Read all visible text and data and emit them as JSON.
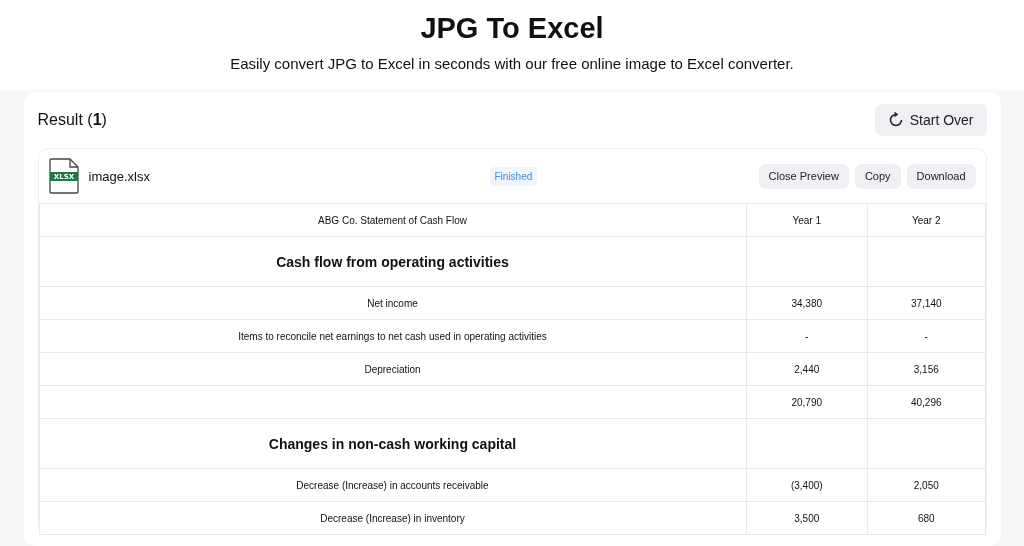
{
  "header": {
    "title": "JPG To Excel",
    "subtitle": "Easily convert JPG to Excel in seconds with our free online image to Excel converter."
  },
  "result": {
    "label": "Result (",
    "count": "1",
    "close": ")",
    "start_over": "Start Over"
  },
  "file": {
    "badge": "XLSX",
    "name": "image.xlsx",
    "status": "Finished",
    "actions": [
      "Close Preview",
      "Copy",
      "Download"
    ]
  },
  "table": {
    "rows": [
      {
        "kind": "text",
        "cells": [
          "ABG Co. Statement of Cash Flow",
          "Year 1",
          "Year 2"
        ]
      },
      {
        "kind": "heading",
        "cells": [
          "Cash flow from operating activities",
          "",
          ""
        ]
      },
      {
        "kind": "text",
        "cells": [
          "Net income",
          "34,380",
          "37,140"
        ]
      },
      {
        "kind": "text",
        "cells": [
          "Items to reconcile net earnings to net cash used in operating activities",
          "-",
          "-"
        ]
      },
      {
        "kind": "text",
        "cells": [
          "Depreciation",
          "2,440",
          "3,156"
        ]
      },
      {
        "kind": "text",
        "cells": [
          "",
          "20,790",
          "40,296"
        ]
      },
      {
        "kind": "heading",
        "cells": [
          "Changes in non-cash working capital",
          "",
          ""
        ]
      },
      {
        "kind": "text",
        "cells": [
          "Decrease (Increase) in accounts receivable",
          "(3,400)",
          "2,050"
        ]
      },
      {
        "kind": "text",
        "cells": [
          "Decrease (Increase) in inventory",
          "3,500",
          "680"
        ]
      }
    ]
  }
}
